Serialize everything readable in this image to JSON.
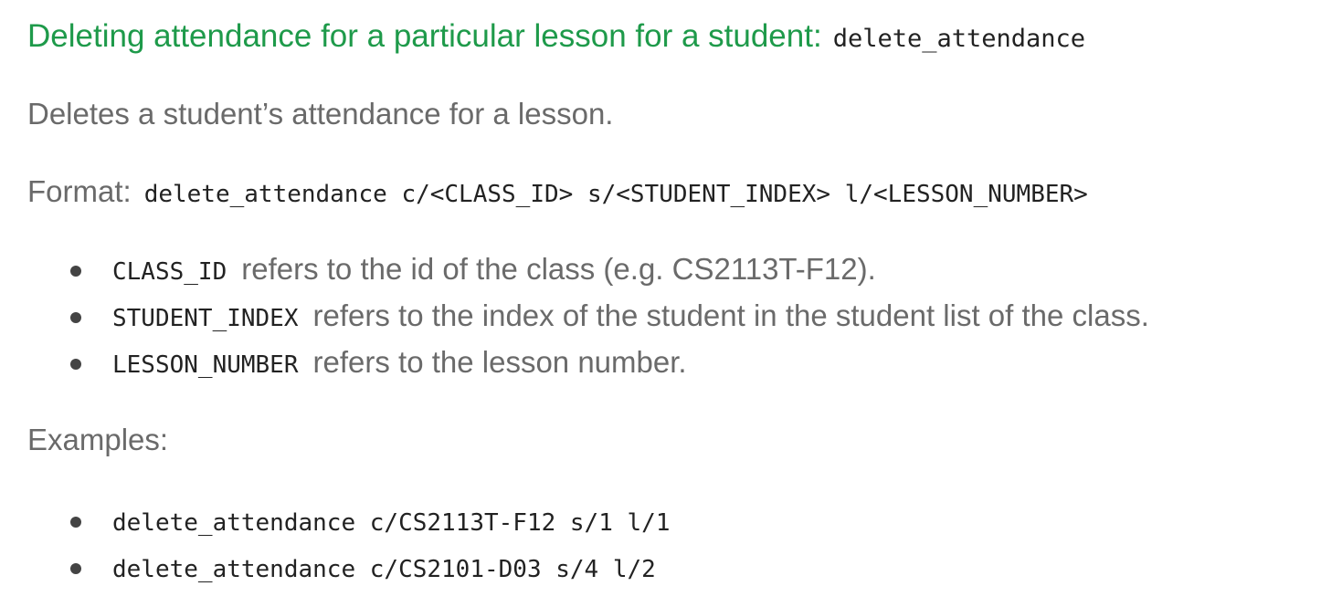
{
  "heading": {
    "text": "Deleting attendance for a particular lesson for a student:",
    "command": "delete_attendance"
  },
  "description": "Deletes a student’s attendance for a lesson.",
  "format": {
    "label": "Format:",
    "syntax": "delete_attendance c/<CLASS_ID> s/<STUDENT_INDEX> l/<LESSON_NUMBER>"
  },
  "parameters": [
    {
      "name": "CLASS_ID",
      "description": "refers to the id of the class (e.g. CS2113T-F12)."
    },
    {
      "name": "STUDENT_INDEX",
      "description": "refers to the index of the student in the student list of the class."
    },
    {
      "name": "LESSON_NUMBER",
      "description": "refers to the lesson number."
    }
  ],
  "examples": {
    "label": "Examples:",
    "items": [
      "delete_attendance c/CS2113T-F12 s/1 l/1",
      "delete_attendance c/CS2101-D03 s/4 l/2"
    ]
  },
  "colors": {
    "heading": "#1e9a4a",
    "body_text": "#6a6a6a",
    "code_text": "#222222",
    "bullet": "#444444"
  }
}
